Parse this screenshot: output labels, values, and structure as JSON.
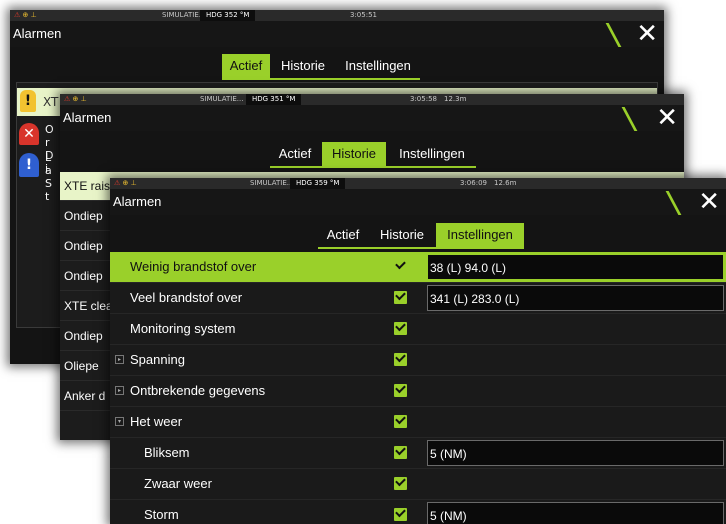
{
  "windows": [
    {
      "status": {
        "sim": "SIMULATIE...",
        "hdg": "HDG 352 °M",
        "time": "3:05:51",
        "dist": ""
      },
      "title": "Alarmen",
      "tabs": [
        "Actief",
        "Historie",
        "Instellingen"
      ],
      "active_tab": "Actief",
      "rows": [
        "XT",
        "Or Di",
        "La St"
      ]
    },
    {
      "status": {
        "sim": "SIMULATIE...",
        "hdg": "HDG 351 °M",
        "time": "3:05:58",
        "dist": "12.3m"
      },
      "title": "Alarmen",
      "tabs": [
        "Actief",
        "Historie",
        "Instellingen"
      ],
      "active_tab": "Historie",
      "rows": [
        "XTE rais",
        "Ondiep",
        "Ondiep",
        "Ondiep",
        "XTE clea",
        "Ondiep",
        "Oliepe",
        "Anker d"
      ]
    },
    {
      "status": {
        "sim": "SIMULATIE...",
        "hdg": "HDG 359 °M",
        "time": "3:06:09",
        "dist": "12.6m"
      },
      "title": "Alarmen",
      "tabs": [
        "Actief",
        "Historie",
        "Instellingen"
      ],
      "active_tab": "Instellingen",
      "settings": [
        {
          "label": "Weinig brandstof over",
          "checked": true,
          "value": "38 (L)  94.0 (L)",
          "selected": true
        },
        {
          "label": "Veel brandstof over",
          "checked": true,
          "value": "341 (L)  283.0 (L)"
        },
        {
          "label": "Monitoring system",
          "checked": true,
          "value": ""
        },
        {
          "label": "Spanning",
          "checked": true,
          "value": "",
          "expander": "collapsed"
        },
        {
          "label": "Ontbrekende gegevens",
          "checked": true,
          "value": "",
          "expander": "collapsed"
        },
        {
          "label": "Het weer",
          "checked": true,
          "value": "",
          "expander": "expanded"
        },
        {
          "label": "Bliksem",
          "checked": true,
          "value": "5 (NM)",
          "indent": true
        },
        {
          "label": "Zwaar weer",
          "checked": true,
          "value": "",
          "indent": true
        },
        {
          "label": "Storm",
          "checked": true,
          "value": "5 (NM)",
          "indent": true
        }
      ]
    }
  ],
  "icons": {
    "close": "close-icon",
    "warning": "warning-icon",
    "alarm": "alarm-bell-icon",
    "expand": "expand-arrow-icon"
  },
  "colors": {
    "accent": "#9ad02a",
    "warning": "#f2c230",
    "alarm": "#d8342b",
    "info": "#2f5fd0"
  }
}
